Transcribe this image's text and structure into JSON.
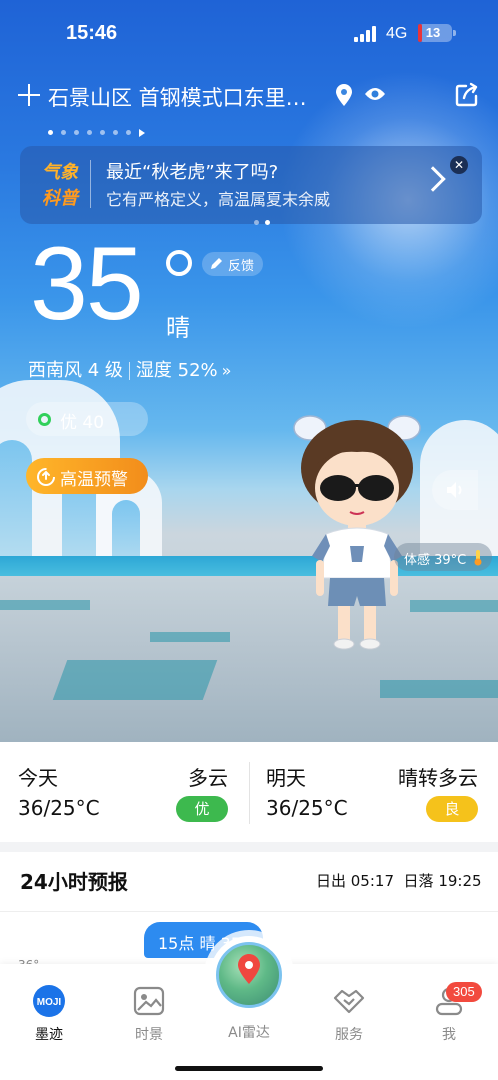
{
  "status_bar": {
    "time": "15:46",
    "network": "4G",
    "battery": "13",
    "battery_level": 0.13
  },
  "location": {
    "name": "石景山区 首钢模式口东里…",
    "page_count": 8,
    "active_page": 0
  },
  "banner": {
    "brand_line1": "气象",
    "brand_line2": "科普",
    "title": "最近“秋老虎”来了吗?",
    "subtitle": "它有严格定义，高温属夏末余威",
    "page_count": 2,
    "active_page": 1
  },
  "current": {
    "temperature": "35",
    "condition": "晴",
    "feedback_label": "反馈",
    "wind": "西南风 4 级",
    "humidity": "湿度 52%",
    "more": "»",
    "aqi_label": "优 40",
    "alert_label": "高温预警",
    "feels_like": "体感 39°C"
  },
  "days": {
    "today": {
      "label": "今天",
      "condition": "多云",
      "range": "36/25°C",
      "aqi": "优",
      "aqi_color": "#3db94e"
    },
    "tomorrow": {
      "label": "明天",
      "condition": "晴转多云",
      "range": "36/25°C",
      "aqi": "良",
      "aqi_color": "#f5c21b"
    }
  },
  "forecast": {
    "title": "24小时预报",
    "sunrise": "日出 05:17",
    "sunset": "日落 19:25",
    "bubble": "15点 晴 35°",
    "y_label": "36°"
  },
  "tabs": [
    {
      "label": "墨迹",
      "icon": "moji-logo-icon",
      "active": true
    },
    {
      "label": "时景",
      "icon": "photo-icon",
      "active": false
    },
    {
      "label": "AI雷达",
      "icon": "radar-globe-icon",
      "active": false
    },
    {
      "label": "服务",
      "icon": "handshake-icon",
      "active": false
    },
    {
      "label": "我",
      "icon": "profile-icon",
      "active": false,
      "badge": "305"
    }
  ],
  "colors": {
    "accent": "#2d8bf0",
    "alert": "#f5a623",
    "aqi_good": "#31d05b",
    "badge": "#f24a3e"
  }
}
